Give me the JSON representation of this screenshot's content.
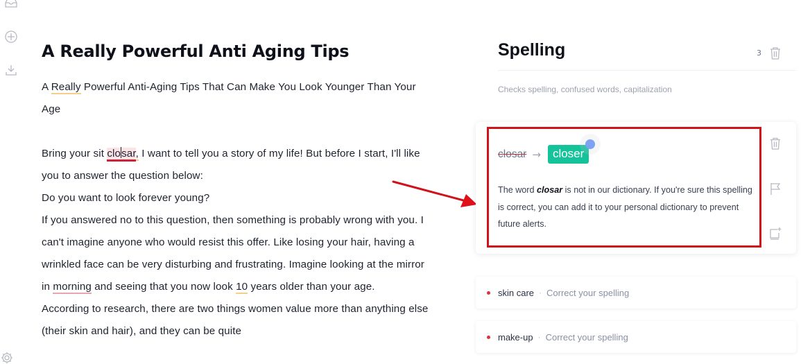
{
  "left_rail": {
    "icons": [
      "inbox-icon",
      "add-circle-icon",
      "download-icon",
      "settings-gear-icon"
    ]
  },
  "document": {
    "title": "A Really Powerful Anti Aging Tips",
    "subtitle_parts": [
      "A ",
      "Really",
      " Powerful Anti-Aging Tips That Can Make You Look Younger Than Your Age"
    ],
    "paragraph1": {
      "before": "Bring your sit ",
      "error_left": "clo",
      "error_right": "sar",
      "comma": ",",
      "after": " I want to tell you a story of my life! But before I start, I'll like you to answer the question below:"
    },
    "line_question": "Do you want to look forever young?",
    "paragraph2": "If you answered no to this question, then something is probably wrong with you. I can't imagine anyone who would resist this offer. Like losing your hair, having a wrinkled face can be very disturbing and frustrating. Imagine looking at the mirror in ",
    "morning": "morning",
    "paragraph2b": " and seeing that you now look ",
    "ten": "10",
    "paragraph2c": " years older than your age.",
    "paragraph3": "According to research, there are two things women value more than anything else (their skin and hair), and they can be quite"
  },
  "sidebar": {
    "title": "Spelling",
    "count": "3",
    "description": "Checks spelling, confused words, capitalization",
    "active_card": {
      "wrong": "closar",
      "arrow": "→",
      "replacement": "closer",
      "desc_before": "The word ",
      "desc_word": "closar",
      "desc_after": " is not in our dictionary. If you're sure this spelling is correct, you can add it to your personal dictionary to prevent future alerts.",
      "actions": [
        "dismiss",
        "flag",
        "add-to-dictionary"
      ]
    },
    "issues": [
      {
        "word": "skin care",
        "sep": "·",
        "hint": "Correct your spelling"
      },
      {
        "word": "make-up",
        "sep": "·",
        "hint": "Correct your spelling"
      }
    ]
  },
  "colors": {
    "accent_green": "#15c39a",
    "error_red": "#d1203a",
    "annotation_red": "#d0121b"
  }
}
